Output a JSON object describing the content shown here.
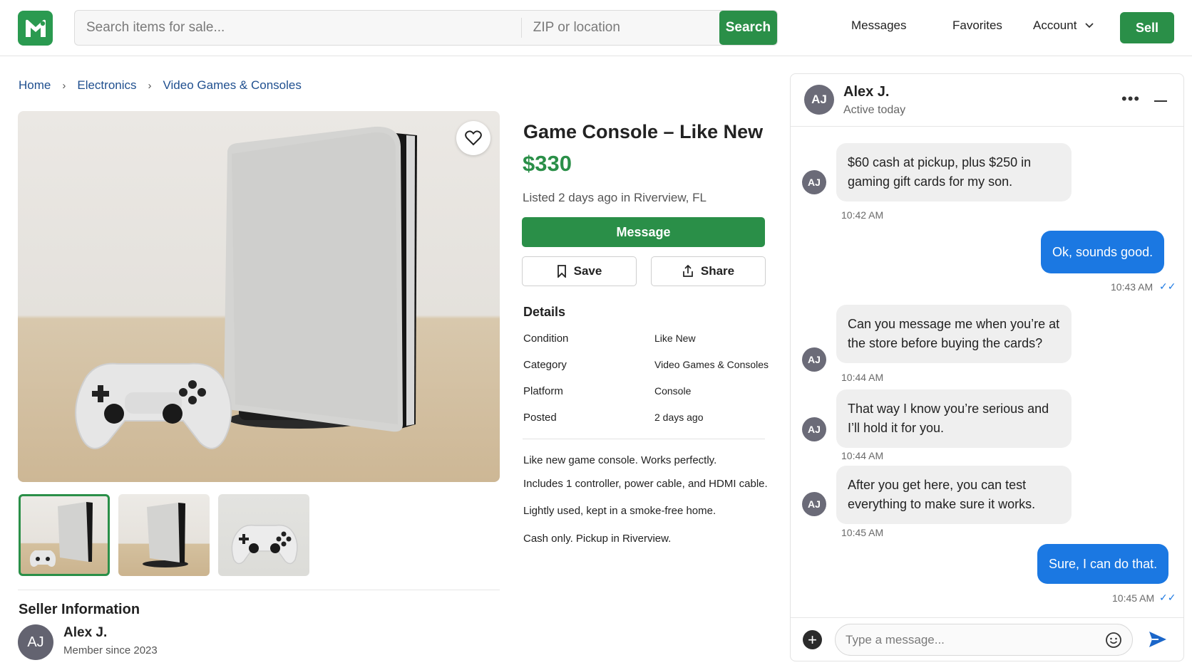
{
  "header": {
    "search_placeholder": "Search items for sale...",
    "zip_placeholder": "ZIP or location",
    "search_button": "Search",
    "nav": {
      "messages": "Messages",
      "favorites": "Favorites",
      "account": "Account"
    },
    "sell_button": "Sell",
    "brand_color": "#2a8f48"
  },
  "breadcrumb": [
    "Home",
    "Electronics",
    "Video Games & Consoles"
  ],
  "listing": {
    "title": "Game Console – Like New",
    "price": "$330",
    "listed": "Listed 2 days ago in Riverview, FL",
    "message_button": "Message",
    "save_button": "Save",
    "share_button": "Share",
    "details_title": "Details",
    "details": [
      {
        "key": "Condition",
        "value": "Like New"
      },
      {
        "key": "Category",
        "value": "Video Games & Consoles"
      },
      {
        "key": "Platform",
        "value": "Console"
      },
      {
        "key": "Posted",
        "value": "2 days ago"
      }
    ],
    "description": [
      "Like new game console. Works perfectly.",
      "Includes 1 controller, power cable, and HDMI cable.",
      "Lightly used, kept in a smoke-free home.",
      "Cash only. Pickup in Riverview."
    ]
  },
  "seller": {
    "section_title": "Seller Information",
    "initials": "AJ",
    "name": "Alex J.",
    "since": "Member since 2023"
  },
  "chat": {
    "contact_name": "Alex J.",
    "contact_status": "Active today",
    "initials": "AJ",
    "messages": [
      {
        "from": "them",
        "text": "$60 cash at pickup, plus $250 in gaming gift cards for my son.",
        "time": "10:42 AM"
      },
      {
        "from": "me",
        "text": "Ok, sounds good.",
        "time": "10:43 AM"
      },
      {
        "from": "them",
        "text": "Can you message me when you’re at the store before buying the cards?",
        "time": "10:44 AM"
      },
      {
        "from": "them",
        "text": "That way I know you’re serious and I’ll hold it for you.",
        "time": "10:44 AM"
      },
      {
        "from": "them",
        "text": "After you get here, you can test everything to make sure it works.",
        "time": "10:45 AM"
      },
      {
        "from": "me",
        "text": "Sure, I can do that.",
        "time": "10:45 AM"
      }
    ],
    "input_placeholder": "Type a message...",
    "outgoing_color": "#1b78e2"
  }
}
